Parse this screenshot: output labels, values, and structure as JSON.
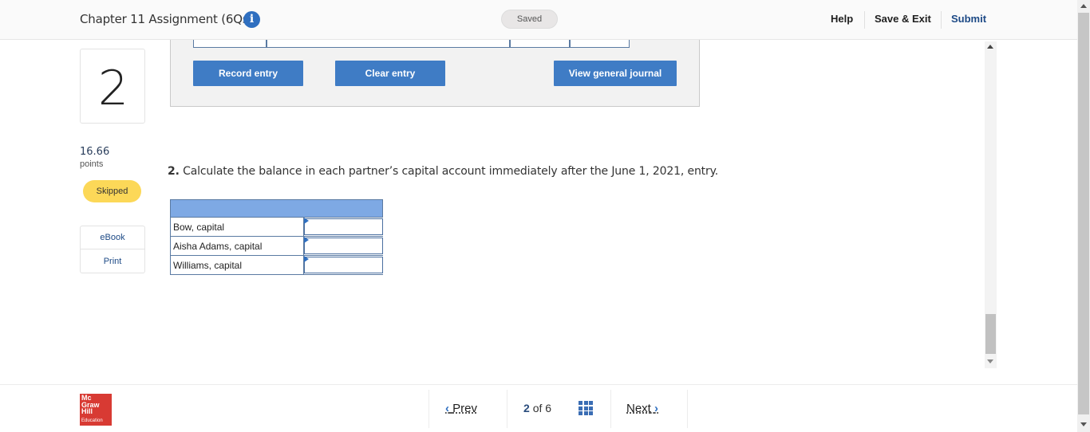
{
  "header": {
    "title": "Chapter 11 Assignment (6Qs)",
    "info_glyph": "i",
    "status": "Saved",
    "help": "Help",
    "save_exit": "Save & Exit",
    "submit": "Submit"
  },
  "sidebar": {
    "question_number": "2",
    "points_value": "16.66",
    "points_label": "points",
    "status_badge": "Skipped",
    "ebook": "eBook",
    "print": "Print"
  },
  "journal": {
    "record_label": "Record entry",
    "clear_label": "Clear entry",
    "view_label": "View general journal"
  },
  "question": {
    "number": "2.",
    "text": " Calculate the balance in each partner’s capital account immediately after the June 1, 2021, entry."
  },
  "capital_table": {
    "rows": [
      {
        "label": "Bow, capital",
        "value": ""
      },
      {
        "label": "Aisha Adams, capital",
        "value": ""
      },
      {
        "label": "Williams, capital",
        "value": ""
      }
    ]
  },
  "footer": {
    "logo_lines": [
      "Mc",
      "Graw",
      "Hill"
    ],
    "logo_sub": "Education",
    "prev": "Prev",
    "current_page": "2",
    "of": "of",
    "total_pages": "6",
    "next": "Next"
  },
  "colors": {
    "accent": "#3f7cc5",
    "brand_red": "#d83a33",
    "badge_skipped": "#fcd858",
    "table_header": "#7ea9e4"
  },
  "icons": [
    "info-icon",
    "chevron-left-icon",
    "grid-icon",
    "chevron-right-icon"
  ]
}
